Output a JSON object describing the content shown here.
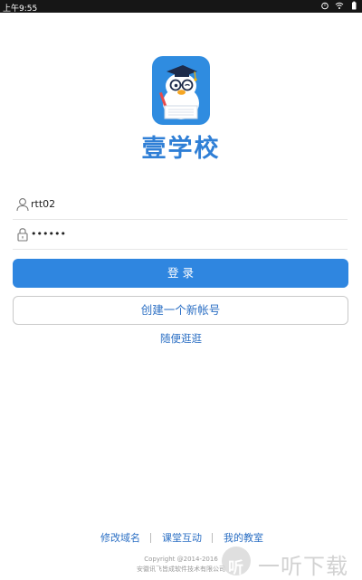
{
  "statusbar": {
    "time": "上午9:55"
  },
  "brand": {
    "name": "壹学校"
  },
  "login": {
    "username_value": "rtt02",
    "password_value": "••••••",
    "login_label": "登 录",
    "create_label": "创建一个新帐号",
    "browse_label": "随便逛逛"
  },
  "footer": {
    "links": [
      "修改域名",
      "课堂互动",
      "我的教室"
    ],
    "copyright_line1": "Copyright @2014-2016",
    "copyright_line2": "安徽讯飞皆成软件技术有限公司"
  },
  "watermark": {
    "text": "一听下载",
    "glyph": "听"
  },
  "colors": {
    "accent": "#2f86e0",
    "link": "#2b6fc4",
    "statusbar": "#161616"
  }
}
